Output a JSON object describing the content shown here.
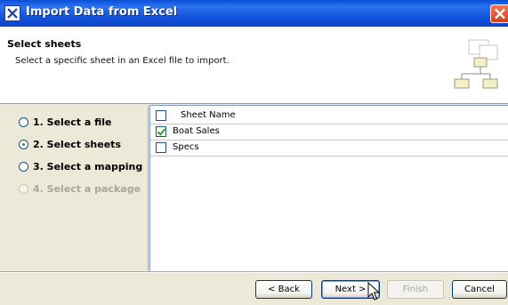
{
  "window": {
    "title": "Import Data from Excel"
  },
  "header": {
    "title": "Select sheets",
    "description": "Select a specific sheet in an Excel file to import."
  },
  "steps": [
    {
      "label": "1. Select a file",
      "selected": false,
      "enabled": true
    },
    {
      "label": "2. Select sheets",
      "selected": true,
      "enabled": true
    },
    {
      "label": "3. Select a mapping",
      "selected": false,
      "enabled": true
    },
    {
      "label": "4. Select a package",
      "selected": false,
      "enabled": false
    }
  ],
  "sheet_table": {
    "header": "Sheet Name",
    "rows": [
      {
        "name": "Boat Sales",
        "checked": true
      },
      {
        "name": "Specs",
        "checked": false
      }
    ]
  },
  "buttons": {
    "back": "< Back",
    "next": "Next >",
    "finish": "Finish",
    "cancel": "Cancel"
  },
  "icons": {
    "title": "excel-import-icon",
    "close": "close-icon",
    "header": "hierarchy-diagram-icon",
    "cursor": "mouse-pointer-icon"
  },
  "colors": {
    "titlebar": "#0a4fd8",
    "close": "#d2431b",
    "dialog_bg": "#ece9d8",
    "check_green": "#21a121"
  }
}
